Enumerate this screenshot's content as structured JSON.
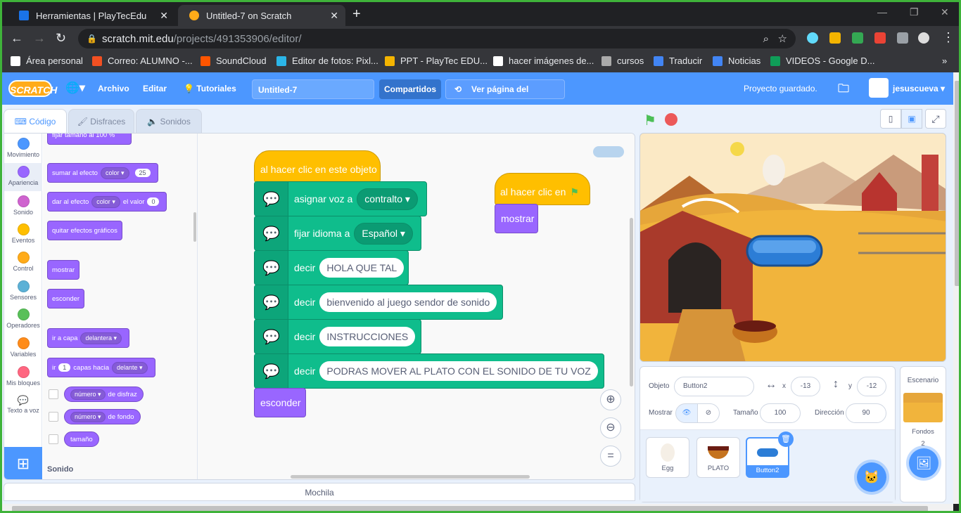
{
  "browser": {
    "tabs": [
      {
        "title": "Herramientas | PlayTecEdu"
      },
      {
        "title": "Untitled-7 on Scratch"
      }
    ],
    "url_host": "scratch.mit.edu",
    "url_path": "/projects/491353906/editor/",
    "bookmarks": [
      "Área personal",
      "Correo: ALUMNO -...",
      "SoundCloud",
      "Editor de fotos: Pixl...",
      "PPT - PlayTec EDU...",
      "hacer imágenes de...",
      "cursos",
      "Traducir",
      "Noticias",
      "VIDEOS - Google D..."
    ]
  },
  "menubar": {
    "logo": "SCRATCH",
    "file": "Archivo",
    "edit": "Editar",
    "tutorials": "Tutoriales",
    "project_title": "Untitled-7",
    "share": "Compartidos",
    "see_project": "Ver página del proyecto",
    "saved_status": "Proyecto guardado.",
    "username": "jesuscueva"
  },
  "editor_tabs": {
    "code": "Código",
    "costumes": "Disfraces",
    "sounds": "Sonidos"
  },
  "categories": [
    {
      "label": "Movimiento",
      "color": "#4c97ff"
    },
    {
      "label": "Apariencia",
      "color": "#9966ff"
    },
    {
      "label": "Sonido",
      "color": "#cf63cf"
    },
    {
      "label": "Eventos",
      "color": "#ffbf00"
    },
    {
      "label": "Control",
      "color": "#ffab19"
    },
    {
      "label": "Sensores",
      "color": "#5cb1d6"
    },
    {
      "label": "Operadores",
      "color": "#59c059"
    },
    {
      "label": "Variables",
      "color": "#ff8c1a"
    },
    {
      "label": "Mis bloques",
      "color": "#ff6680"
    },
    {
      "label": "Texto a voz",
      "color": "#0fbd8c"
    }
  ],
  "palette": {
    "partial_top": "fijar tamaño al 100 %",
    "b1": {
      "label": "sumar al efecto",
      "dd": "color",
      "val": "25"
    },
    "b2": {
      "label": "dar al efecto",
      "dd": "color",
      "mid": "el valor",
      "val": "0"
    },
    "b3": "quitar efectos gráficos",
    "b4": "mostrar",
    "b5": "esconder",
    "b6": {
      "label": "ir a capa",
      "dd": "delantera"
    },
    "b7": {
      "label": "ir",
      "val": "1",
      "mid": "capas hacia",
      "dd": "delante"
    },
    "r1": {
      "dd": "número",
      "label": "de disfraz"
    },
    "r2": {
      "dd": "número",
      "label": "de fondo"
    },
    "r3": "tamaño",
    "section_sound": "Sonido"
  },
  "script": {
    "hat1": "al hacer clic en este objeto",
    "voice_label": "asignar voz a",
    "voice_value": "contralto",
    "lang_label": "fijar idioma a",
    "lang_value": "Español",
    "say_label": "decir",
    "say1": "HOLA QUE TAL",
    "say2": "bienvenido al juego sendor de sonido",
    "say3": "INSTRUCCIONES",
    "say4": "PODRAS MOVER AL PLATO CON EL SONIDO DE TU VOZ",
    "hide": "esconder",
    "hat2": "al hacer clic en",
    "show": "mostrar"
  },
  "backpack": "Mochila",
  "sprite_info": {
    "object_label": "Objeto",
    "object_name": "Button2",
    "x_label": "x",
    "x_value": "-13",
    "y_label": "y",
    "y_value": "-12",
    "show_label": "Mostrar",
    "size_label": "Tamaño",
    "size_value": "100",
    "direction_label": "Dirección",
    "direction_value": "90"
  },
  "sprites": [
    {
      "name": "Egg"
    },
    {
      "name": "PLATO"
    },
    {
      "name": "Button2"
    }
  ],
  "stage_panel": {
    "title": "Escenario",
    "backdrops_label": "Fondos",
    "backdrops_count": "2"
  }
}
